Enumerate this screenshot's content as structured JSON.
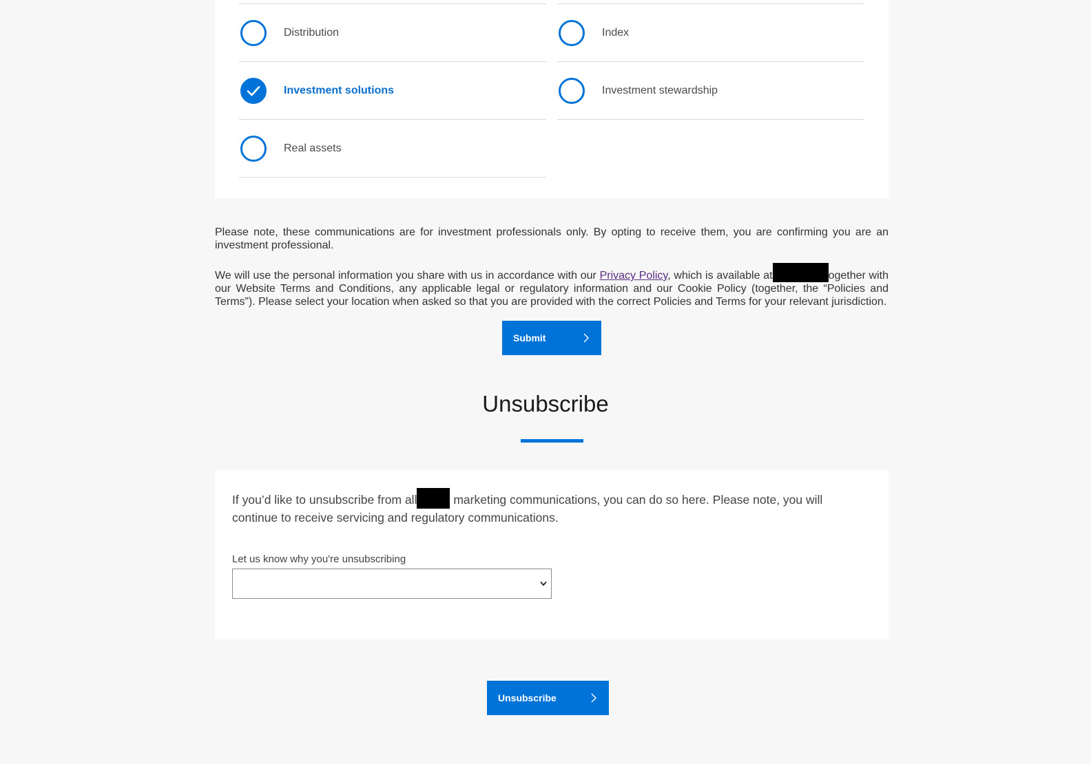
{
  "topics": {
    "left": [
      {
        "label": "Distribution",
        "checked": false
      },
      {
        "label": "Investment solutions",
        "checked": true
      },
      {
        "label": "Real assets",
        "checked": false
      }
    ],
    "right": [
      {
        "label": "Index",
        "checked": false
      },
      {
        "label": "Investment stewardship",
        "checked": false
      }
    ]
  },
  "notice": {
    "professionals": "Please note, these communications are for investment professionals only. By opting to receive them, you are confirming you are an investment professional.",
    "privacy_before": "We will use the personal information you share with us in accordance with our ",
    "privacy_link": "Privacy Policy",
    "privacy_middle": ", which is available at",
    "privacy_after": "ogether with our Website Terms and Conditions, any applicable legal or regulatory information and our Cookie Policy (together, the “Policies and Terms”). Please select your location when asked so that you are provided with the correct Policies and Terms for your relevant jurisdiction."
  },
  "submit": {
    "label": "Submit"
  },
  "unsubscribe_section": {
    "title": "Unsubscribe",
    "text_before": "If you’d like to unsubscribe from all",
    "text_after": " marketing communications, you can do so here. Please note, you will continue to receive servicing and regulatory communications.",
    "reason_label": "Let us know why you're unsubscribing",
    "reason_value": "",
    "button_label": "Unsubscribe"
  },
  "colors": {
    "accent": "#0073d9",
    "background": "#f7f7f7",
    "card": "#ffffff",
    "link": "#5a2d82"
  },
  "icons": {
    "checked": "checkmark-icon",
    "button_arrow": "chevron-right-icon",
    "select_arrow": "chevron-down-icon"
  }
}
